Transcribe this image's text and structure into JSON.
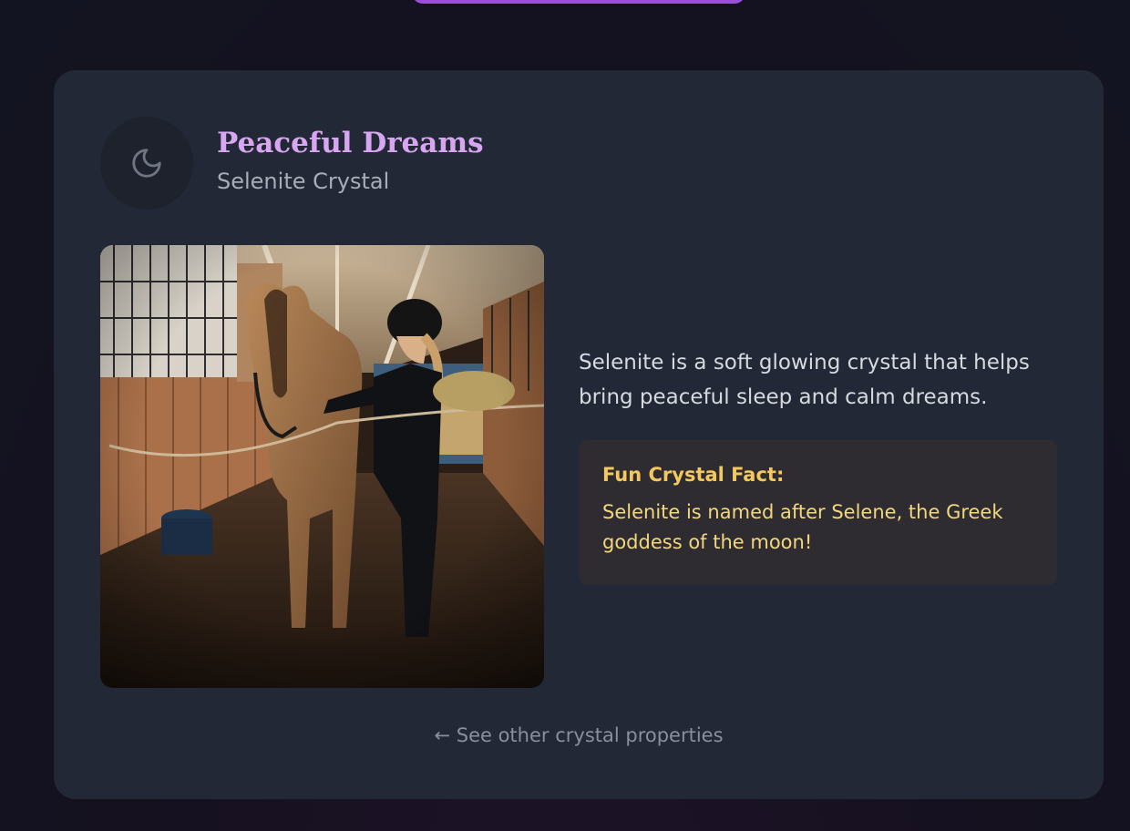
{
  "card": {
    "title": "Peaceful Dreams",
    "subtitle": "Selenite Crystal",
    "icon": "moon-icon",
    "description": "Selenite is a soft glowing crystal that helps bring peaceful sleep and calm dreams.",
    "fact": {
      "label": "Fun Crystal Fact:",
      "text": "Selenite is named after Selene, the Greek goddess of the moon!"
    },
    "back_link": "← See other crystal properties"
  },
  "colors": {
    "page_background": "#15111f",
    "card_background": "#222835",
    "title": "#d8a6f0",
    "accent_pill": "#9b4ddb",
    "fact_background": "#2e2c31",
    "fact_text": "#f3d77e"
  }
}
